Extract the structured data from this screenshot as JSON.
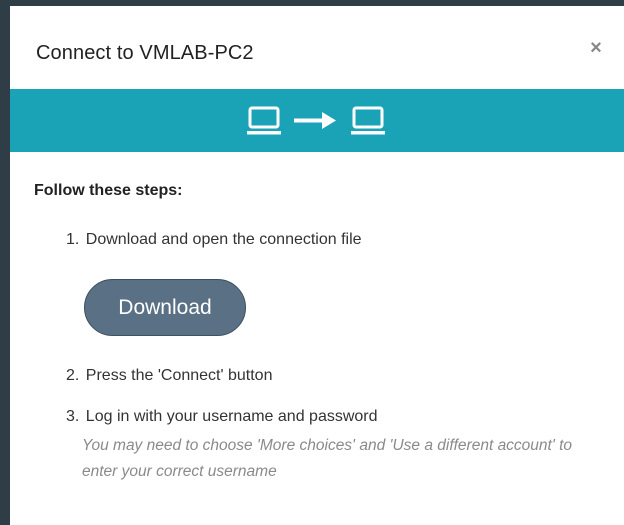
{
  "dialog": {
    "title": "Connect to VMLAB-PC2",
    "close_glyph": "×"
  },
  "banner": {
    "color": "#1aa3b7",
    "icons": [
      "laptop-icon",
      "arrow-right-icon",
      "laptop-icon"
    ]
  },
  "steps": {
    "heading": "Follow these steps:",
    "items": [
      {
        "num": "1.",
        "text": "Download and open the connection file"
      },
      {
        "num": "2.",
        "text": "Press the 'Connect' button"
      },
      {
        "num": "3.",
        "text": "Log in with your username and password"
      }
    ],
    "download_label": "Download",
    "hint": "You may need to choose 'More choices' and 'Use a different account' to enter your correct username"
  },
  "colors": {
    "accent": "#1aa3b7",
    "button": "#5a7085"
  }
}
